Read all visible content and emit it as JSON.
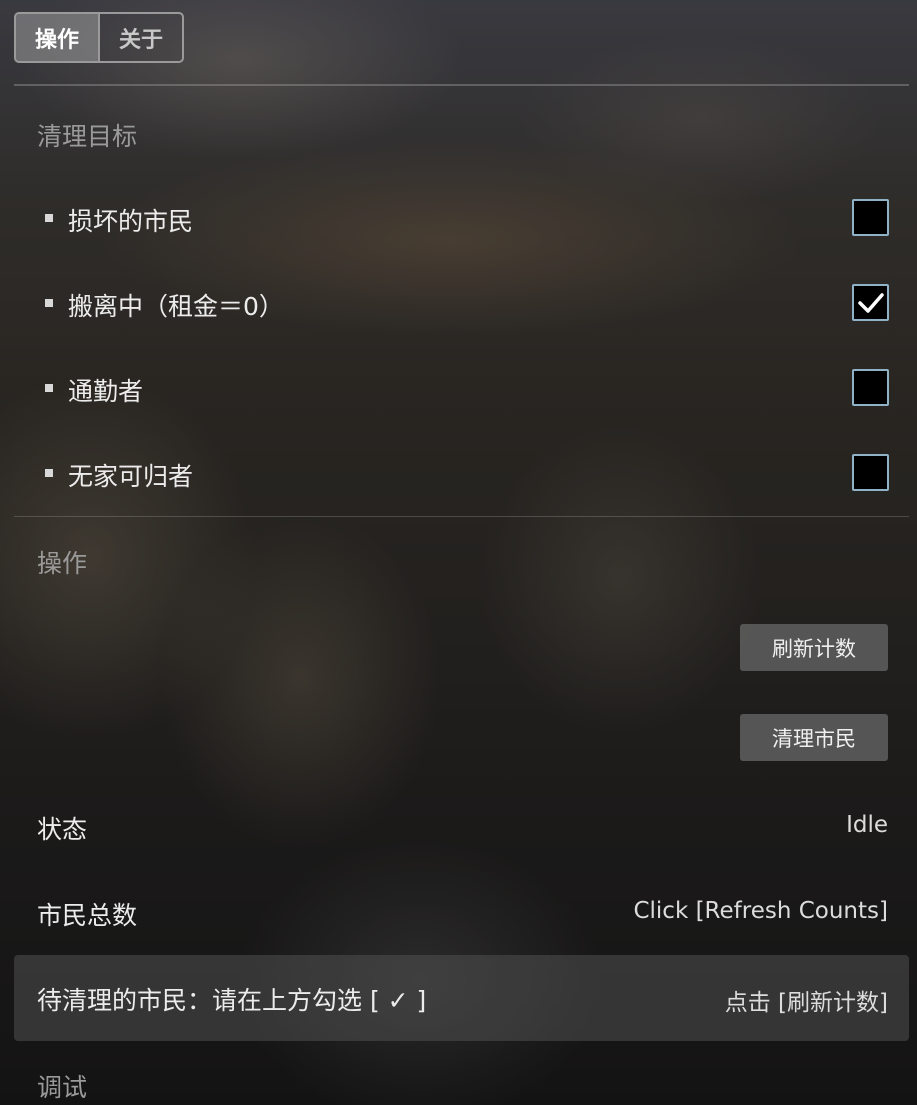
{
  "tabs": [
    {
      "label": "操作",
      "active": true
    },
    {
      "label": "关于",
      "active": false
    }
  ],
  "sections": {
    "cleanup_targets_title": "清理目标",
    "actions_title": "操作",
    "debug_title": "调试"
  },
  "options": [
    {
      "label": "损坏的市民",
      "checked": false
    },
    {
      "label": "搬离中（租金＝0）",
      "checked": true
    },
    {
      "label": "通勤者",
      "checked": false
    },
    {
      "label": "无家可归者",
      "checked": false
    }
  ],
  "buttons": {
    "refresh_counts": "刷新计数",
    "clean_citizens": "清理市民"
  },
  "status": {
    "label": "状态",
    "value": "Idle"
  },
  "total_citizens": {
    "label": "市民总数",
    "value": "Click [Refresh Counts]"
  },
  "pending_cleanup": {
    "label": "待清理的市民：请在上方勾选 [ ✓ ]",
    "value": "点击 [刷新计数]"
  },
  "colors": {
    "checkbox_border": "#8fb2c6",
    "button_bg": "#5f5f5f",
    "section_title": "#9a9a9a"
  }
}
